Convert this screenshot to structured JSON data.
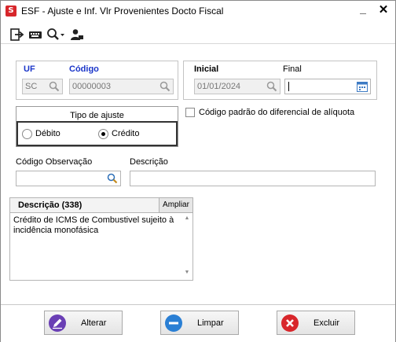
{
  "window": {
    "title": "ESF - Ajuste e Inf. Vlr Provenientes Docto Fiscal",
    "minimize_glyph": "_",
    "close_glyph": "✕"
  },
  "toolbar": {
    "icons": [
      "exit-icon",
      "keyboard-icon",
      "search-dropdown-icon",
      "user-icon"
    ]
  },
  "form": {
    "uf_label": "UF",
    "uf_value": "SC",
    "codigo_label": "Código",
    "codigo_value": "00000003",
    "inicial_label": "Inicial",
    "inicial_value": "01/01/2024",
    "final_label": "Final",
    "final_value": "",
    "tipo_ajuste_label": "Tipo de ajuste",
    "debito_label": "Débito",
    "credito_label": "Crédito",
    "selected_tipo": "Crédito",
    "codigo_padrao_label": "Código padrão do diferencial de alíquota",
    "codigo_padrao_checked": false,
    "codigo_obs_label": "Código Observação",
    "codigo_obs_value": "",
    "descricao_label": "Descrição",
    "descricao_value": ""
  },
  "memo": {
    "header": "Descrição (338)",
    "ampliar_label": "Ampliar",
    "text": "Crédito de ICMS de Combustivel sujeito à incidência monofásica"
  },
  "footer": {
    "alterar_label": "Alterar",
    "limpar_label": "Limpar",
    "excluir_label": "Excluir"
  },
  "colors": {
    "accent_blue": "#1a35c9",
    "alterar_icon": "#6a3fb5",
    "limpar_icon": "#2a7fd4",
    "excluir_icon": "#d8262b"
  }
}
